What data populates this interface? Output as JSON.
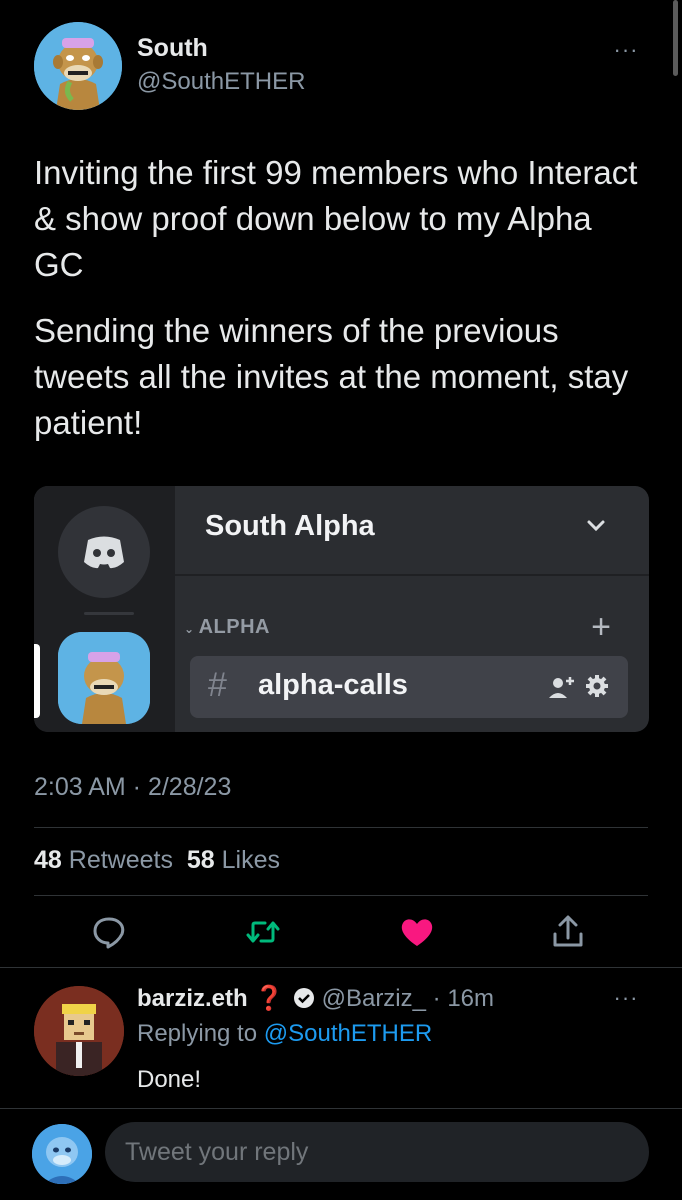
{
  "tweet": {
    "author_name": "South",
    "author_handle": "@SouthETHER",
    "more_icon": "···",
    "paragraphs": [
      "Inviting the first 99 members who Interact & show proof down below to my Alpha GC",
      "Sending the winners of the previous tweets all the invites at the moment, stay patient!"
    ],
    "timestamp": "2:03 AM · 2/28/23",
    "retweets_count": "48",
    "retweets_label": "Retweets",
    "likes_count": "58",
    "likes_label": "Likes",
    "liked": true
  },
  "discord_card": {
    "server_name": "South Alpha",
    "category": "ALPHA",
    "channel_hash": "#",
    "channel_name": "alpha-calls"
  },
  "actions": [
    {
      "icon": "reply-icon"
    },
    {
      "icon": "retweet-icon"
    },
    {
      "icon": "like-heart-icon"
    },
    {
      "icon": "share-icon"
    }
  ],
  "reply": {
    "name": "barziz.eth",
    "name_emoji": "❓",
    "handle": "@Barziz_",
    "time": "· 16m",
    "replying_prefix": "Replying to",
    "replying_handle": "@SouthETHER",
    "text": "Done!"
  },
  "composer": {
    "placeholder": "Tweet your reply"
  },
  "colors": {
    "background": "#000000",
    "text": "#e7e9ea",
    "muted": "#8b98a5",
    "link": "#1d9bf0",
    "like_pink": "#f91880",
    "retweet_green": "#00ba7c",
    "discord_bg": "#2b2d31"
  }
}
